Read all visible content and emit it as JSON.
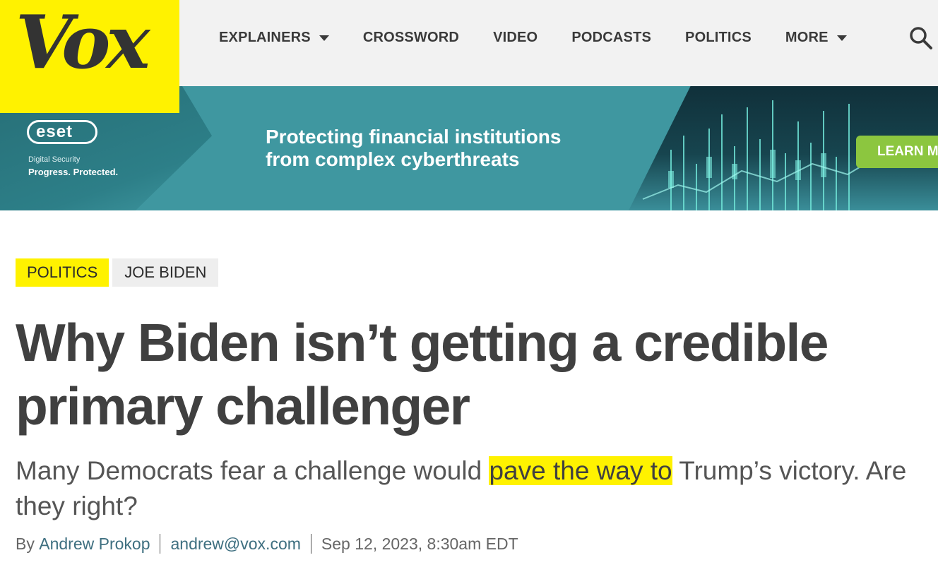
{
  "header": {
    "logo": "Vox",
    "nav": [
      {
        "label": "EXPLAINERS",
        "dropdown": true
      },
      {
        "label": "CROSSWORD",
        "dropdown": false
      },
      {
        "label": "VIDEO",
        "dropdown": false
      },
      {
        "label": "PODCASTS",
        "dropdown": false
      },
      {
        "label": "POLITICS",
        "dropdown": false
      },
      {
        "label": "MORE",
        "dropdown": true
      }
    ],
    "search_icon": "search-icon"
  },
  "ad": {
    "brand": "eset",
    "brand_line1": "Digital Security",
    "brand_line2": "Progress. Protected.",
    "headline": "Protecting financial institutions from complex cyberthreats",
    "cta": "LEARN M"
  },
  "article": {
    "tags": [
      "POLITICS",
      "JOE BIDEN"
    ],
    "title": "Why Biden isn’t getting a credible primary challenger",
    "dek_before": "Many Democrats fear a challenge would ",
    "dek_highlight": "pave the way to",
    "dek_after": " Trump’s victory. Are they right?",
    "byline_prefix": "By ",
    "author": "Andrew Prokop",
    "email": "andrew@vox.com",
    "date": "Sep 12, 2023, 8:30am EDT"
  },
  "colors": {
    "brand_yellow": "#fff200",
    "headline_text": "#404040",
    "link": "#3e6f80",
    "ad_teal": "#3f97a0",
    "ad_cta": "#8cc63f"
  }
}
